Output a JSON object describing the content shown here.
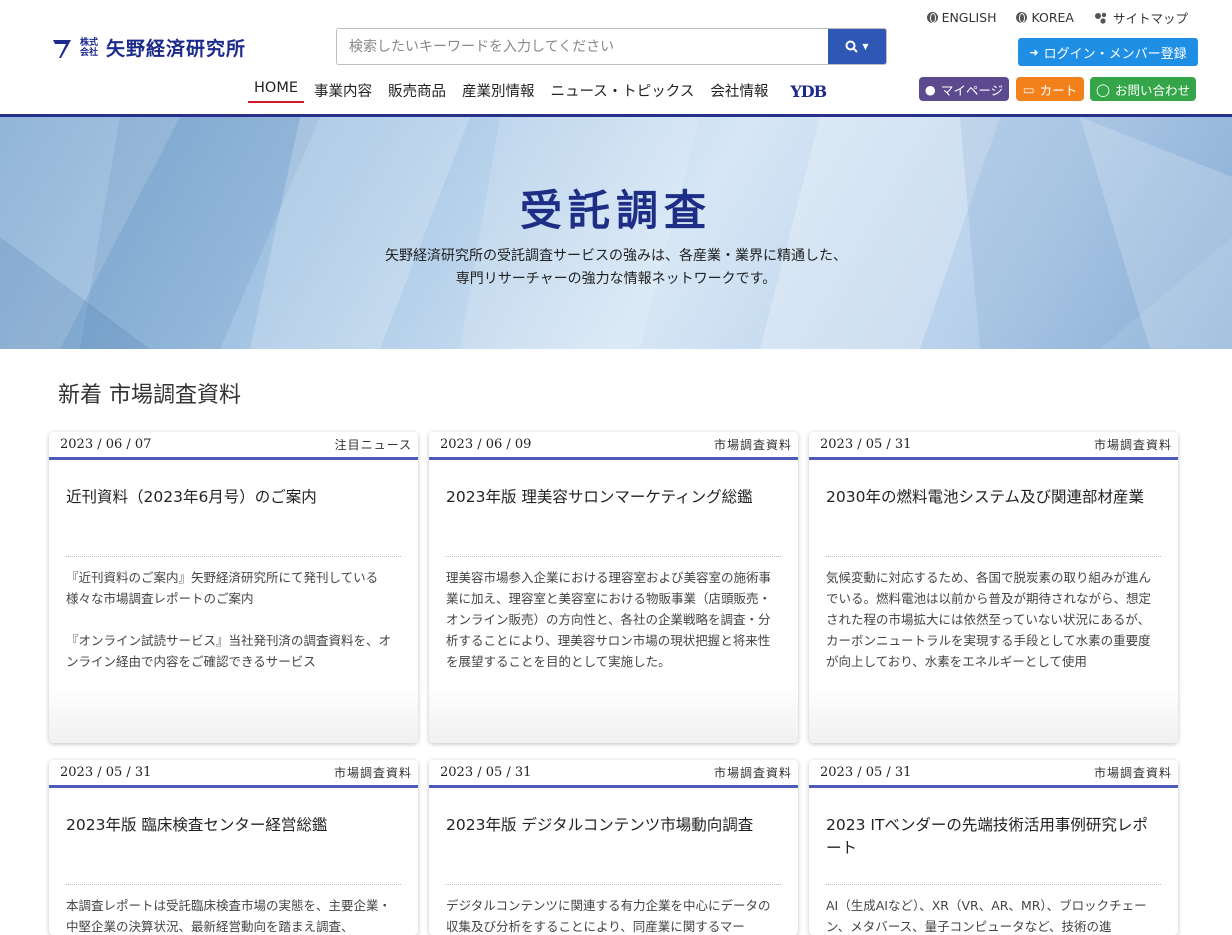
{
  "logo": {
    "kabu_top": "株式",
    "kabu_bottom": "会社",
    "name": "矢野経済研究所"
  },
  "search": {
    "placeholder": "検索したいキーワードを入力してください"
  },
  "toplinks": [
    {
      "label": "ENGLISH",
      "icon": "globe-icon"
    },
    {
      "label": "KOREA",
      "icon": "globe-icon"
    },
    {
      "label": "サイトマップ",
      "icon": "sitemap-icon"
    }
  ],
  "login_label": "ログイン・メンバー登録",
  "nav": [
    {
      "label": "HOME",
      "active": true
    },
    {
      "label": "事業内容"
    },
    {
      "label": "販売商品"
    },
    {
      "label": "産業別情報"
    },
    {
      "label": "ニュース・トピックス"
    },
    {
      "label": "会社情報"
    }
  ],
  "nav_ydb": "YDB",
  "pills": {
    "mypage": "マイページ",
    "cart": "カート",
    "contact": "お問い合わせ"
  },
  "colors": {
    "brand": "#1c2a8c",
    "accent_underline": "#d6192a",
    "search_button": "#2f57b5",
    "login": "#1f8fe6",
    "mypage": "#5b4a8e",
    "cart": "#f2811b",
    "contact": "#35a54a",
    "card_rule": "#4d5ab8"
  },
  "hero": {
    "title": "受託調査",
    "line1": "矢野経済研究所の受託調査サービスの強みは、各産業・業界に精通した、",
    "line2": "専門リサーチャーの強力な情報ネットワークです。"
  },
  "section_title": "新着 市場調査資料",
  "cards": [
    {
      "date": "2023 / 06 / 07",
      "category": "注目ニュース",
      "title": "近刊資料（2023年6月号）のご案内",
      "desc": "『近刊資料のご案内』矢野経済研究所にて発刊している様々な市場調査レポートのご案内\n\n『オンライン試読サービス』当社発刊済の調査資料を、オンライン経由で内容をご確認できるサービス"
    },
    {
      "date": "2023 / 06 / 09",
      "category": "市場調査資料",
      "title": "2023年版 理美容サロンマーケティング総鑑",
      "desc": "理美容市場参入企業における理容室および美容室の施術事業に加え、理容室と美容室における物販事業（店頭販売・オンライン販売）の方向性と、各社の企業戦略を調査・分析することにより、理美容サロン市場の現状把握と将来性を展望することを目的として実施した。"
    },
    {
      "date": "2023 / 05 / 31",
      "category": "市場調査資料",
      "title": "2030年の燃料電池システム及び関連部材産業",
      "desc": "気候変動に対応するため、各国で脱炭素の取り組みが進んでいる。燃料電池は以前から普及が期待されながら、想定された程の市場拡大には依然至っていない状況にあるが、カーボンニュートラルを実現する手段として水素の重要度が向上しており、水素をエネルギーとして使用"
    },
    {
      "date": "2023 / 05 / 31",
      "category": "市場調査資料",
      "title": "2023年版 臨床検査センター経営総鑑",
      "desc": "本調査レポートは受託臨床検査市場の実態を、主要企業・中堅企業の決算状況、最新経営動向を踏まえ調査、"
    },
    {
      "date": "2023 / 05 / 31",
      "category": "市場調査資料",
      "title": "2023年版 デジタルコンテンツ市場動向調査",
      "desc": "デジタルコンテンツに関連する有力企業を中心にデータの収集及び分析をすることにより、同産業に関するマー"
    },
    {
      "date": "2023 / 05 / 31",
      "category": "市場調査資料",
      "title": "2023 ITベンダーの先端技術活用事例研究レポート",
      "desc": "AI（生成AIなど）、XR（VR、AR、MR）、ブロックチェーン、メタバース、量子コンピュータなど、技術の進"
    }
  ]
}
